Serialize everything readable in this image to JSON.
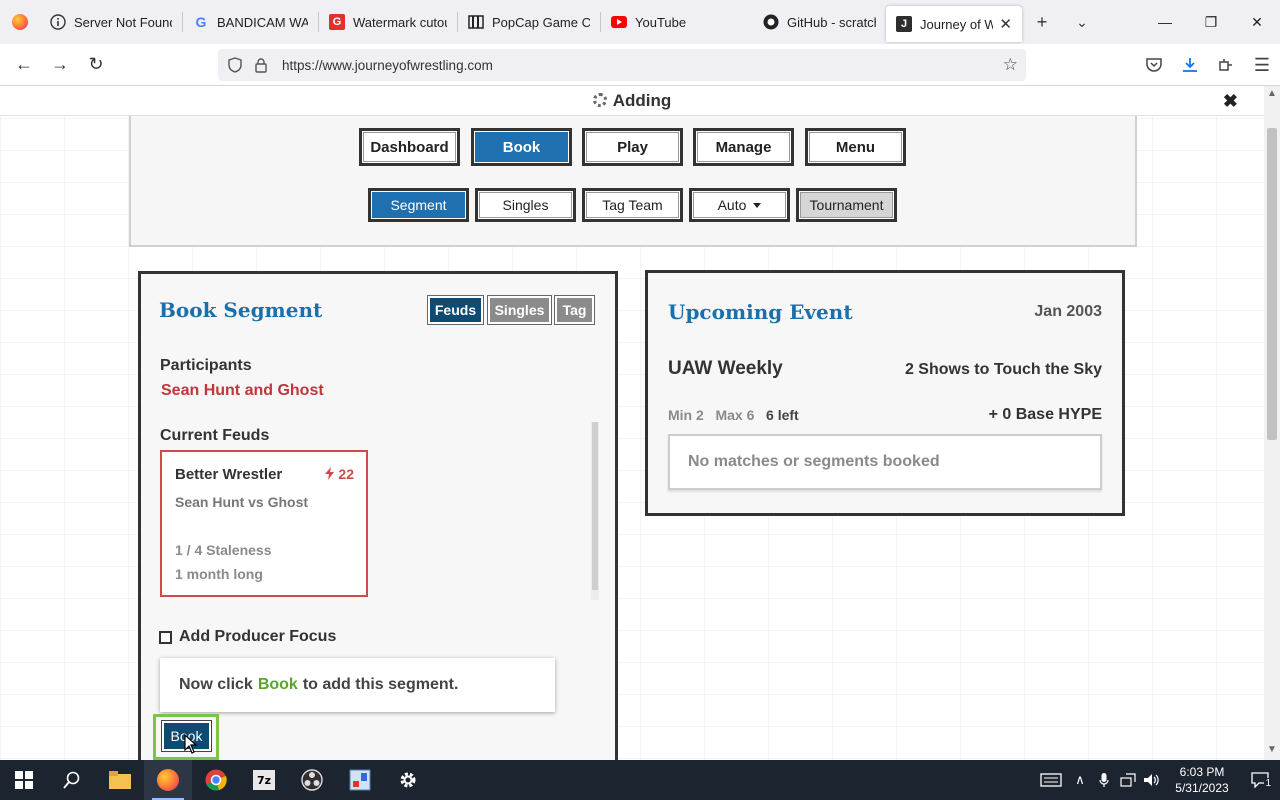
{
  "browser": {
    "tabs": [
      {
        "title": "Server Not Found",
        "favicon": "info-icon"
      },
      {
        "title": "BANDICAM WATE",
        "favicon": "google-icon"
      },
      {
        "title": "Watermark cutout",
        "favicon": "g-red-icon"
      },
      {
        "title": "PopCap Game Col",
        "favicon": "popcap-icon"
      },
      {
        "title": "YouTube",
        "favicon": "youtube-icon"
      },
      {
        "title": "GitHub - scratchfo",
        "favicon": "github-icon"
      },
      {
        "title": "Journey of Wre",
        "favicon": "j-icon",
        "active": true
      }
    ],
    "url": "https://www.journeyofwrestling.com"
  },
  "status": {
    "text": "Adding"
  },
  "nav": {
    "main": [
      "Dashboard",
      "Book",
      "Play",
      "Manage",
      "Menu"
    ],
    "main_selected": "Book",
    "sub": [
      "Segment",
      "Singles",
      "Tag Team",
      "Auto",
      "Tournament"
    ],
    "sub_selected": "Segment"
  },
  "book_segment": {
    "title": "Book Segment",
    "filters": [
      "Feuds",
      "Singles",
      "Tag"
    ],
    "participants_label": "Participants",
    "participants": "Sean Hunt and Ghost",
    "current_feuds_label": "Current Feuds",
    "feud": {
      "name": "Better Wrestler",
      "heat": "22",
      "vs": "Sean Hunt vs Ghost",
      "staleness": "1 / 4  Staleness",
      "length": "1 month long"
    },
    "producer_focus_label": "Add Producer Focus",
    "tip_prefix": "Now click",
    "tip_highlight": "Book",
    "tip_suffix": "to add this segment.",
    "book_button": "Book"
  },
  "upcoming_event": {
    "title": "Upcoming Event",
    "date": "Jan 2003",
    "show": "UAW Weekly",
    "venue": "2 Shows to Touch the Sky",
    "min": "Min 2",
    "max": "Max 6",
    "left": "6 left",
    "hype": "+ 0 Base HYPE",
    "empty": "No matches or segments booked"
  },
  "taskbar": {
    "time": "6:03 PM",
    "date": "5/31/2023",
    "notification_count": "1"
  },
  "colors": {
    "accent": "#1e70b0",
    "dark_pill": "#0e4a72",
    "feud_red": "#d14a4a",
    "tip_green": "#5aa62a"
  }
}
